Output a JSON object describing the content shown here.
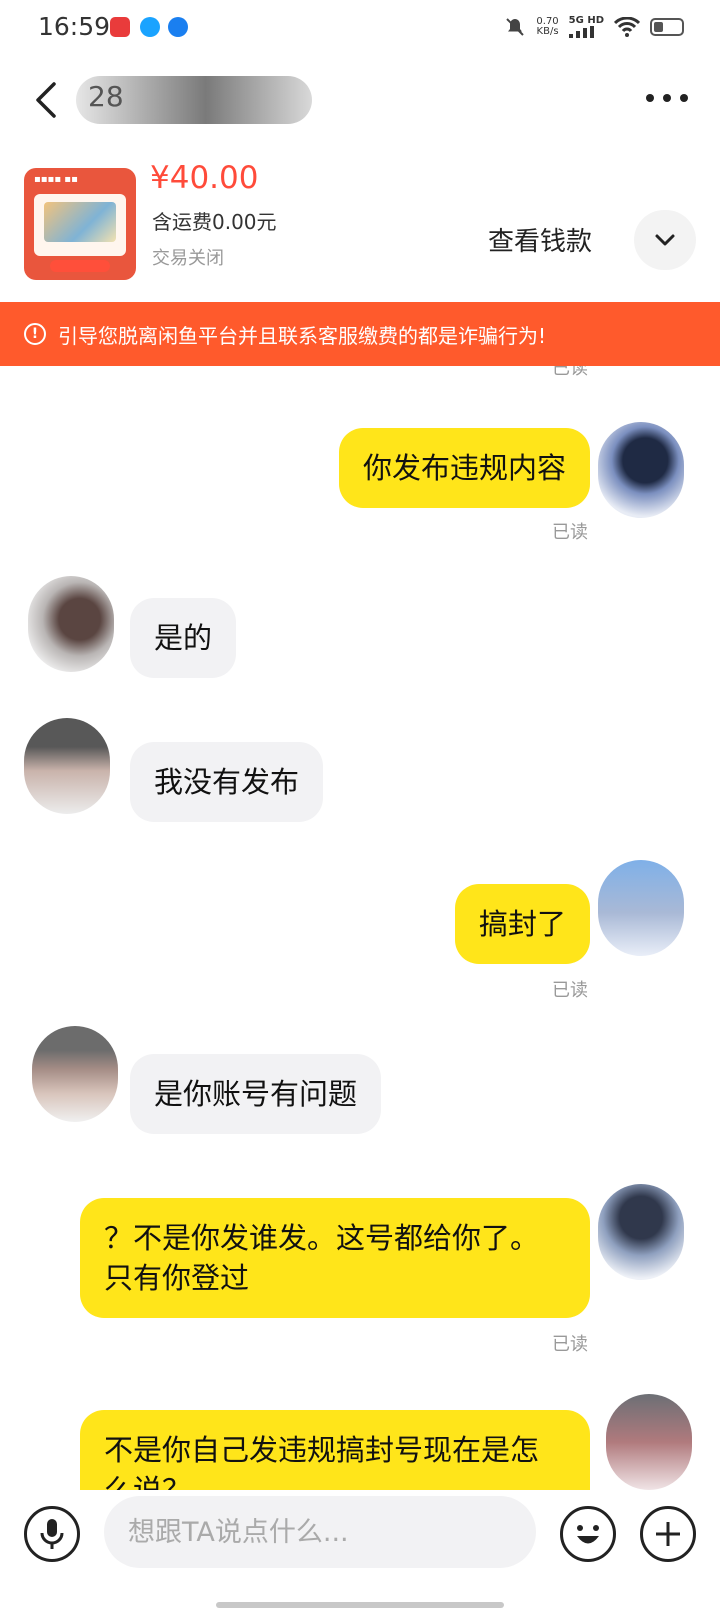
{
  "status_bar": {
    "time": "16:59",
    "net_speed_value": "0.70",
    "net_speed_unit": "KB/s",
    "network_type": "5G HD",
    "battery_level": 0.35,
    "app_icons": [
      {
        "name": "app-notification-icon",
        "color": "#e93b3b"
      },
      {
        "name": "qq-icon",
        "color": "#1aa3ff"
      },
      {
        "name": "k-app-icon",
        "color": "#1a7ff0"
      }
    ]
  },
  "header": {
    "peer_name_visible": "28"
  },
  "product": {
    "price": "¥40.00",
    "shipping": "含运费0.00元",
    "status": "交易关闭",
    "view_payment_label": "查看钱款"
  },
  "warning": {
    "icon": "!",
    "text": "引导您脱离闲鱼平台并且联系客服缴费的都是诈骗行为!"
  },
  "messages": [
    {
      "direction": "out",
      "text": "你发布违规内容",
      "read_label": "已读"
    },
    {
      "direction": "in",
      "text": "是的"
    },
    {
      "direction": "in",
      "text": "我没有发布"
    },
    {
      "direction": "out",
      "text": "搞封了",
      "read_label": "已读"
    },
    {
      "direction": "in",
      "text": "是你账号有问题"
    },
    {
      "direction": "out",
      "text": "？不是你发谁发。这号都给你了。只有你登过",
      "read_label": "已读"
    },
    {
      "direction": "out",
      "text": "不是你自己发违规搞封号现在是怎么说？"
    }
  ],
  "top_read_label": "已读",
  "input": {
    "placeholder": "想跟TA说点什么..."
  },
  "colors": {
    "outgoing_bubble": "#ffe51a",
    "incoming_bubble": "#f2f2f4",
    "warning_banner": "#ff5a2c",
    "price": "#ff4b3a"
  }
}
